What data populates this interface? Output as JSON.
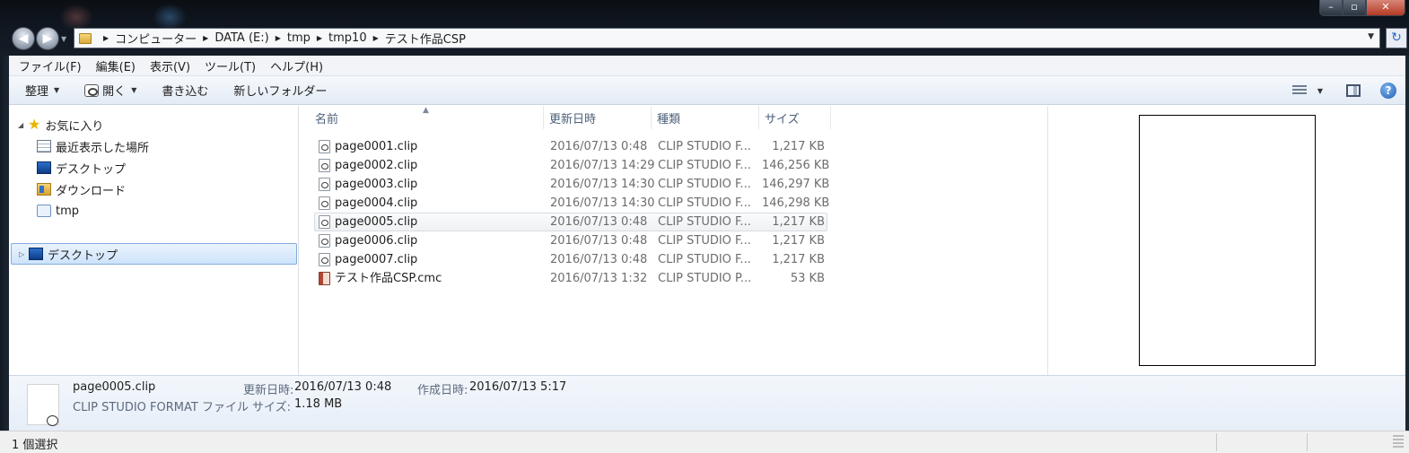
{
  "window": {
    "minimize_icon": "minimize-icon",
    "maximize_icon": "maximize-icon",
    "close_icon": "close-icon"
  },
  "address": {
    "crumbs": [
      "コンピューター",
      "DATA (E:)",
      "tmp",
      "tmp10",
      "テスト作品CSP"
    ]
  },
  "menu": [
    "ファイル(F)",
    "編集(E)",
    "表示(V)",
    "ツール(T)",
    "ヘルプ(H)"
  ],
  "toolbar": {
    "organize": "整理",
    "open": "開く",
    "burn": "書き込む",
    "new_folder": "新しいフォルダー"
  },
  "nav": {
    "favorites": "お気に入り",
    "items": [
      "最近表示した場所",
      "デスクトップ",
      "ダウンロード",
      "tmp"
    ],
    "desktop": "デスクトップ"
  },
  "columns": {
    "name": "名前",
    "modified": "更新日時",
    "type": "種類",
    "size": "サイズ"
  },
  "files": [
    {
      "name": "page0001.clip",
      "date": "2016/07/13 0:48",
      "type": "CLIP STUDIO F...",
      "size": "1,217 KB"
    },
    {
      "name": "page0002.clip",
      "date": "2016/07/13 14:29",
      "type": "CLIP STUDIO F...",
      "size": "146,256 KB"
    },
    {
      "name": "page0003.clip",
      "date": "2016/07/13 14:30",
      "type": "CLIP STUDIO F...",
      "size": "146,297 KB"
    },
    {
      "name": "page0004.clip",
      "date": "2016/07/13 14:30",
      "type": "CLIP STUDIO F...",
      "size": "146,298 KB"
    },
    {
      "name": "page0005.clip",
      "date": "2016/07/13 0:48",
      "type": "CLIP STUDIO F...",
      "size": "1,217 KB"
    },
    {
      "name": "page0006.clip",
      "date": "2016/07/13 0:48",
      "type": "CLIP STUDIO F...",
      "size": "1,217 KB"
    },
    {
      "name": "page0007.clip",
      "date": "2016/07/13 0:48",
      "type": "CLIP STUDIO F...",
      "size": "1,217 KB"
    },
    {
      "name": "テスト作品CSP.cmc",
      "date": "2016/07/13 1:32",
      "type": "CLIP STUDIO P...",
      "size": "53 KB"
    }
  ],
  "details": {
    "name": "page0005.clip",
    "type": "CLIP STUDIO FORMAT ファイル",
    "modified_label": "更新日時:",
    "modified": "2016/07/13 0:48",
    "created_label": "作成日時:",
    "created": "2016/07/13 5:17",
    "size_label": "サイズ:",
    "size": "1.18 MB"
  },
  "status": {
    "selection": "1 個選択"
  }
}
